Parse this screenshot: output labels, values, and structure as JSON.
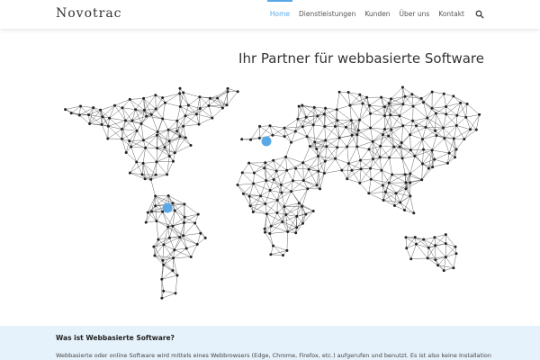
{
  "header": {
    "logo": "Novotrac",
    "nav": [
      {
        "label": "Home",
        "active": true
      },
      {
        "label": "Dienstleistungen",
        "active": false
      },
      {
        "label": "Kunden",
        "active": false
      },
      {
        "label": "Über uns",
        "active": false
      },
      {
        "label": "Kontakt",
        "active": false
      }
    ],
    "search_icon": "search-icon"
  },
  "hero": {
    "title": "Ihr Partner für webbasierte Software"
  },
  "map": {
    "line_color": "#555555",
    "node_color": "#222222",
    "marker_color": "#5aa9e6",
    "markers": [
      "europe-marker",
      "south-america-marker"
    ]
  },
  "info": {
    "heading": "Was ist Webbasierte Software?",
    "text": "Webbasierte oder online Software wird mittels eines Webbrowsers (Edge, Chrome, Firefox, etc.) aufgerufen und benutzt. Es ist also keine Installation"
  },
  "colors": {
    "accent": "#5aa9e6",
    "info_background": "#e6f2fb"
  }
}
